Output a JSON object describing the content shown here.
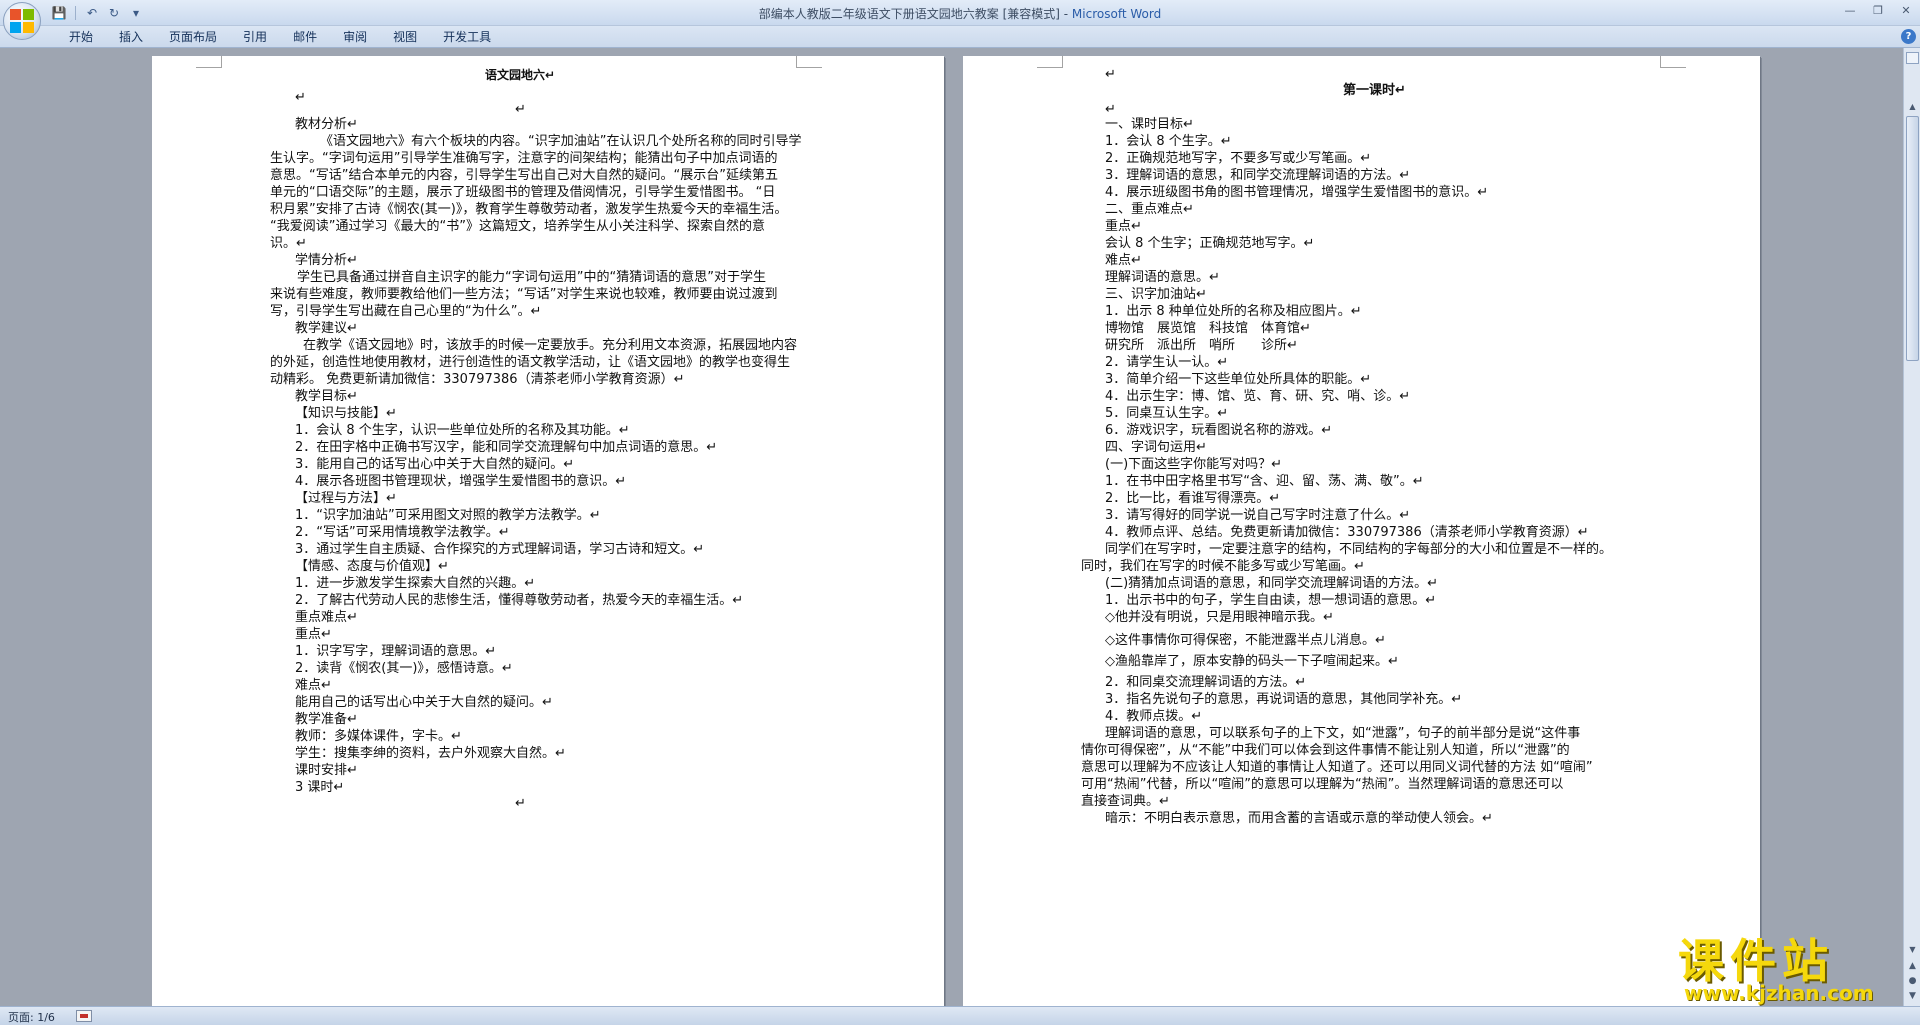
{
  "window": {
    "title": "部编本人教版二年级语文下册语文园地六教案 [兼容模式] - ",
    "app_name": "Microsoft Word"
  },
  "ribbon": {
    "tabs": [
      "开始",
      "插入",
      "页面布局",
      "引用",
      "邮件",
      "审阅",
      "视图",
      "开发工具"
    ]
  },
  "left_page": {
    "lines": [
      "语文园地六↵",
      "↵",
      "↵",
      "教材分析↵",
      "《语文园地六》有六个板块的内容。“识字加油站”在认识几个处所名称的同时引导学",
      "生认字。“字词句运用”引导学生准确写字，注意字的间架结构；能猜出句子中加点词语的",
      "意思。“写话”结合本单元的内容，引导学生写出自己对大自然的疑问。“展示台”延续第五",
      "单元的“口语交际”的主题，展示了班级图书的管理及借阅情况，引导学生爱惜图书。 “日",
      "积月累”安排了古诗《悯农(其一)》，教育学生尊敬劳动者，激发学生热爱今天的幸福生活。",
      "“我爱阅读”通过学习《最大的“书”》这篇短文，培养学生从小关注科学、探索自然的意",
      "识。↵",
      "学情分析↵",
      "学生已具备通过拼音自主识字的能力“字词句运用”中的“猜猜词语的意思”对于学生",
      "来说有些难度，教师要教给他们一些方法；“写话”对学生来说也较难，教师要由说过渡到",
      "写，引导学生写出藏在自己心里的“为什么”。↵",
      "教学建议↵",
      "在教学《语文园地》时，该放手的时候一定要放手。充分利用文本资源，拓展园地内容",
      "的外延，创造性地使用教材，进行创造性的语文教学活动，让《语文园地》的教学也变得生",
      "动精彩。 免费更新请加微信：330797386（清茶老师小学教育资源）↵",
      "教学目标↵",
      "【知识与技能】↵",
      "1．会认 8 个生字，认识一些单位处所的名称及其功能。↵",
      "2．在田字格中正确书写汉字，能和同学交流理解句中加点词语的意思。↵",
      "3．能用自己的话写出心中关于大自然的疑问。↵",
      "4．展示各班图书管理现状，增强学生爱惜图书的意识。↵",
      "【过程与方法】↵",
      "1．“识字加油站”可采用图文对照的教学方法教学。↵",
      "2．“写话”可采用情境教学法教学。↵",
      "3．通过学生自主质疑、合作探究的方式理解词语，学习古诗和短文。↵",
      "【情感、态度与价值观】↵",
      "1．进一步激发学生探索大自然的兴趣。↵",
      "2．了解古代劳动人民的悲惨生活，懂得尊敬劳动者，热爱今天的幸福生活。↵",
      "重点难点↵",
      "重点↵",
      "1．识字写字，理解词语的意思。↵",
      "2．读背《悯农(其一)》，感悟诗意。↵",
      "难点↵",
      "能用自己的话写出心中关于大自然的疑问。↵",
      "教学准备↵",
      "教师：多媒体课件，字卡。↵",
      "学生：搜集李绅的资料，去户外观察大自然。↵",
      "课时安排↵",
      "3 课时↵",
      "↵"
    ]
  },
  "right_page": {
    "lines": [
      "↵",
      "第一课时↵",
      "↵",
      "一、课时目标↵",
      "1．会认 8 个生字。↵",
      "2．正确规范地写字，不要多写或少写笔画。↵",
      "3．理解词语的意思，和同学交流理解词语的方法。↵",
      "4．展示班级图书角的图书管理情况，增强学生爱惜图书的意识。↵",
      "二、重点难点↵",
      "重点↵",
      "会认 8 个生字；正确规范地写字。↵",
      "难点↵",
      "理解词语的意思。↵",
      "三、识字加油站↵",
      "1．出示 8 种单位处所的名称及相应图片。↵",
      "博物馆　展览馆　科技馆　体育馆↵",
      "研究所　派出所　哨所　　诊所↵",
      "2．请学生认一认。↵",
      "3．简单介绍一下这些单位处所具体的职能。↵",
      "4．出示生字：博、馆、览、育、研、究、哨、诊。↵",
      "5．同桌互认生字。↵",
      "6．游戏识字，玩看图说名称的游戏。↵",
      "四、字词句运用↵",
      "(一)下面这些字你能写对吗？↵",
      "1．在书中田字格里书写“含、迎、留、荡、满、敬”。↵",
      "2．比一比，看谁写得漂亮。↵",
      "3．请写得好的同学说一说自己写字时注意了什么。↵",
      "4．教师点评、总结。免费更新请加微信：330797386（清茶老师小学教育资源）↵",
      "同学们在写字时，一定要注意字的结构，不同结构的字每部分的大小和位置是不一样的。",
      "同时，我们在写字的时候不能多写或少写笔画。↵",
      "(二)猜猜加点词语的意思，和同学交流理解词语的方法。↵",
      "1．出示书中的句子，学生自由读，想一想词语的意思。↵",
      "◇他并没有明说，只是用眼神暗示我。↵",
      "◇这件事情你可得保密，不能泄露半点儿消息。↵",
      "◇渔船靠岸了，原本安静的码头一下子喧闹起来。↵",
      "2．和同桌交流理解词语的方法。↵",
      "3．指名先说句子的意思，再说词语的意思，其他同学补充。↵",
      "4．教师点拨。↵",
      "理解词语的意思，可以联系句子的上下文，如“泄露”，句子的前半部分是说“这件事",
      "情你可得保密”，从“不能”中我们可以体会到这件事情不能让别人知道，所以“泄露”的",
      "意思可以理解为不应该让人知道的事情让人知道了。还可以用同义词代替的方法 如“喧闹”",
      "可用“热闹”代替，所以“喧闹”的意思可以理解为“热闹”。当然理解词语的意思还可以",
      "直接查词典。↵",
      "暗示：不明白表示意思，而用含蓄的言语或示意的举动使人领会。↵"
    ]
  },
  "status": {
    "page_info": "页面: 1/6"
  },
  "watermark": {
    "main": "课件站",
    "url": "www.kjzhan.com"
  }
}
